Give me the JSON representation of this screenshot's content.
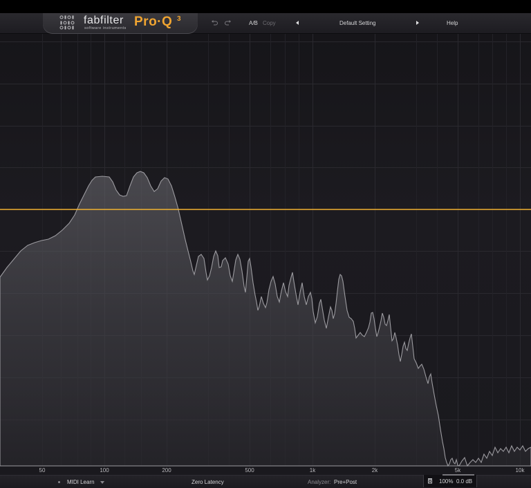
{
  "header": {
    "brand": "fabfilter",
    "brand_sub": "software instruments",
    "product": "Pro·Q",
    "product_version": "3",
    "ab_label": "A/B",
    "copy_label": "Copy",
    "preset_name": "Default Setting",
    "help_label": "Help"
  },
  "graph": {
    "freq_labels": [
      {
        "text": "50"
      },
      {
        "text": "100"
      },
      {
        "text": "200"
      },
      {
        "text": "500"
      },
      {
        "text": "1k"
      },
      {
        "text": "2k"
      },
      {
        "text": "5k"
      },
      {
        "text": "10k"
      }
    ],
    "eq_line_color": "#f2b230",
    "spectrum_color": "#8a898e"
  },
  "footer": {
    "midi_learn": "MIDI Learn",
    "latency": "Zero Latency",
    "analyzer_label": "Analyzer:",
    "analyzer_value": "Pre+Post",
    "output_scale": "100%",
    "output_gain": "0.0 dB"
  }
}
